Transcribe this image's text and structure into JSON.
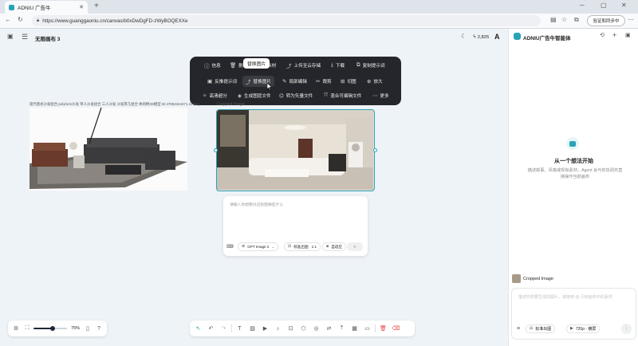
{
  "browser": {
    "tab_title": "ADNIU 广告牛",
    "url": "https://www.guanggaoniu.cn/canvas/b0xDwDgFD-zWyBOQEXXe",
    "sync_label": "验证和同步中"
  },
  "header": {
    "title": "无限画布 3",
    "credits": "2,825",
    "font_label": "A"
  },
  "toolbar": {
    "tooltip": "替换图片",
    "row1": [
      "信息",
      "删除",
      "素材",
      "上传至云存储",
      "下载",
      "复制提示词"
    ],
    "row2": [
      "反推提示词",
      "替换图片",
      "局部编辑",
      "裁剪",
      "切图",
      "放大"
    ],
    "row3": [
      "高清超分",
      "生成图层文件",
      "转为矢量文件",
      "混合可编辑文件",
      "更多"
    ]
  },
  "left_image": {
    "caption": "现代意式沙发组合 polyform沙发 单人沙发组合 三人沙发 沙发茶几组合 休闲椅3D模型 ID:47853444471.22.png"
  },
  "right_image": {
    "caption": "Cropped Image"
  },
  "prompt_box": {
    "placeholder": "请输入你想要对这张图做些什么",
    "model": "GPT Image 2",
    "quality": "标准出图 · 1:1",
    "ratio": "自适应"
  },
  "bottom": {
    "zoom": "75%"
  },
  "panel": {
    "title": "ADNIU广告牛智能体",
    "heading": "从一个想法开始",
    "desc": "描述故事、风格或现有素材，Agent 会与你协调并直接操作当前画布",
    "attachment": "Cropped Image",
    "input_placeholder": "描述你想要生成的图片，或使用 @ 引用画布中的素材",
    "quality": "标准出图",
    "resolution": "720p · 横屏"
  },
  "colors": {
    "accent": "#2aa2b7",
    "dark_toolbar": "#25262b"
  }
}
